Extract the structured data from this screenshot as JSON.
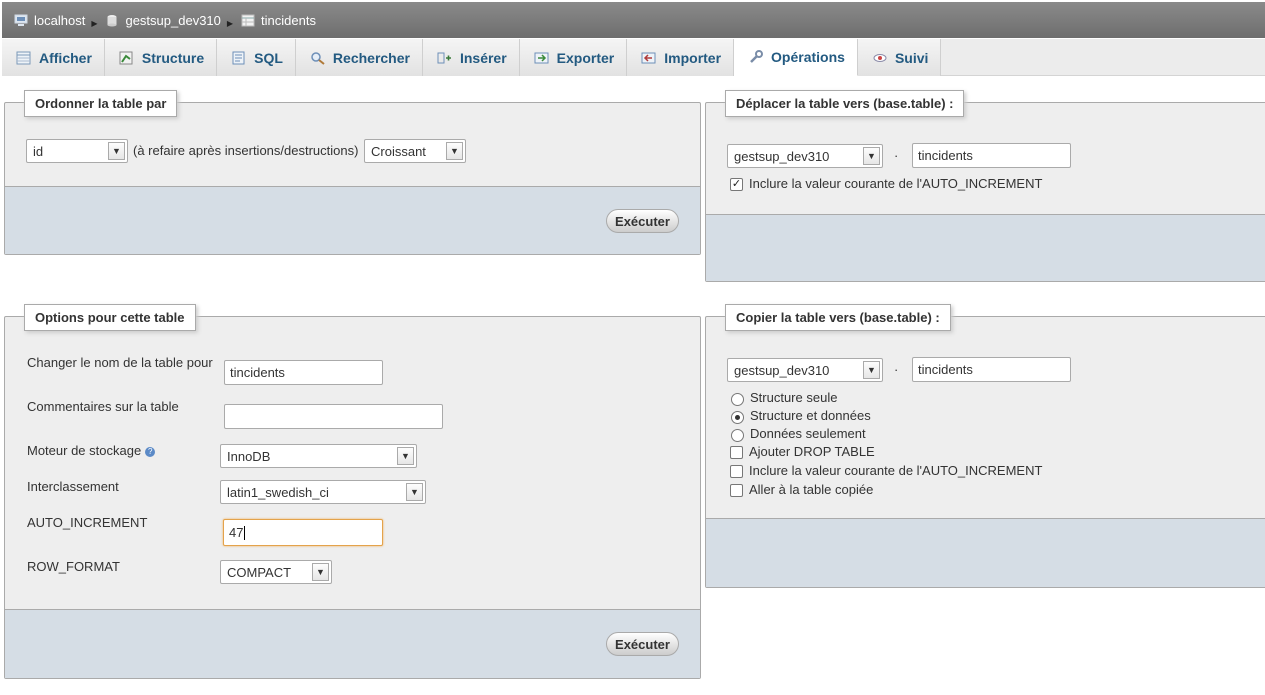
{
  "breadcrumb": {
    "server": "localhost",
    "database": "gestsup_dev310",
    "table": "tincidents"
  },
  "tabs": [
    {
      "label": "Afficher",
      "icon": "browse-icon"
    },
    {
      "label": "Structure",
      "icon": "structure-icon"
    },
    {
      "label": "SQL",
      "icon": "sql-icon"
    },
    {
      "label": "Rechercher",
      "icon": "search-icon"
    },
    {
      "label": "Insérer",
      "icon": "insert-icon"
    },
    {
      "label": "Exporter",
      "icon": "export-icon"
    },
    {
      "label": "Importer",
      "icon": "import-icon"
    },
    {
      "label": "Opérations",
      "icon": "wrench-icon",
      "active": true
    },
    {
      "label": "Suivi",
      "icon": "eye-icon"
    }
  ],
  "order": {
    "legend": "Ordonner la table par",
    "column_value": "id",
    "note": "(à refaire après insertions/destructions)",
    "direction_value": "Croissant",
    "submit": "Exécuter"
  },
  "move": {
    "legend": "Déplacer la table vers (base.table) :",
    "db_value": "gestsup_dev310",
    "separator": "·",
    "table_value": "tincidents",
    "auto_increment_label": "Inclure la valeur courante de l'AUTO_INCREMENT",
    "auto_increment_checked": true
  },
  "options": {
    "legend": "Options pour cette table",
    "rename_label": "Changer le nom de la table pour",
    "rename_value": "tincidents",
    "comment_label": "Commentaires sur la table",
    "comment_value": "",
    "engine_label": "Moteur de stockage",
    "engine_value": "InnoDB",
    "collation_label": "Interclassement",
    "collation_value": "latin1_swedish_ci",
    "auto_increment_label": "AUTO_INCREMENT",
    "auto_increment_value": "47",
    "row_format_label": "ROW_FORMAT",
    "row_format_value": "COMPACT",
    "submit": "Exécuter"
  },
  "copy": {
    "legend": "Copier la table vers (base.table) :",
    "db_value": "gestsup_dev310",
    "separator": "·",
    "table_value": "tincidents",
    "radio_structure": "Structure seule",
    "radio_structure_data": "Structure et données",
    "radio_data": "Données seulement",
    "selected_radio": "Structure et données",
    "drop_table_label": "Ajouter DROP TABLE",
    "auto_increment_label": "Inclure la valeur courante de l'AUTO_INCREMENT",
    "goto_label": "Aller à la table copiée"
  }
}
